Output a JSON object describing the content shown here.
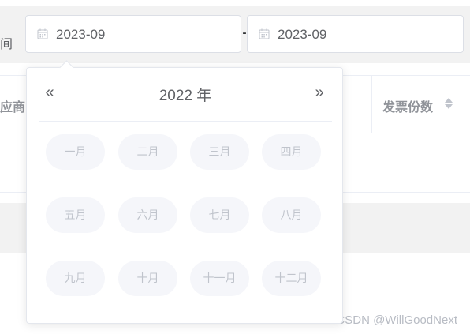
{
  "filter": {
    "label_fragment": "间",
    "range_separator": "-",
    "start_date": "2023-09",
    "end_date": "2023-09"
  },
  "table": {
    "left_column_header_fragment": "应商",
    "invoice_count_header": "发票份数"
  },
  "picker": {
    "prev_year_glyph": "«",
    "next_year_glyph": "»",
    "year_title": "2022 年",
    "months": [
      "一月",
      "二月",
      "三月",
      "四月",
      "五月",
      "六月",
      "七月",
      "八月",
      "九月",
      "十月",
      "十一月",
      "十二月"
    ]
  },
  "watermark": "CSDN @WillGoodNext",
  "colors": {
    "text_primary": "#606266",
    "text_disabled": "#c0c4cc",
    "header_text": "#909399",
    "border": "#dcdfe6",
    "bar_bg": "#f2f2f2",
    "cell_bg": "#f5f6fa"
  },
  "icons": {
    "date_input": "calendar-icon",
    "sort": "sort-caret-icon"
  }
}
